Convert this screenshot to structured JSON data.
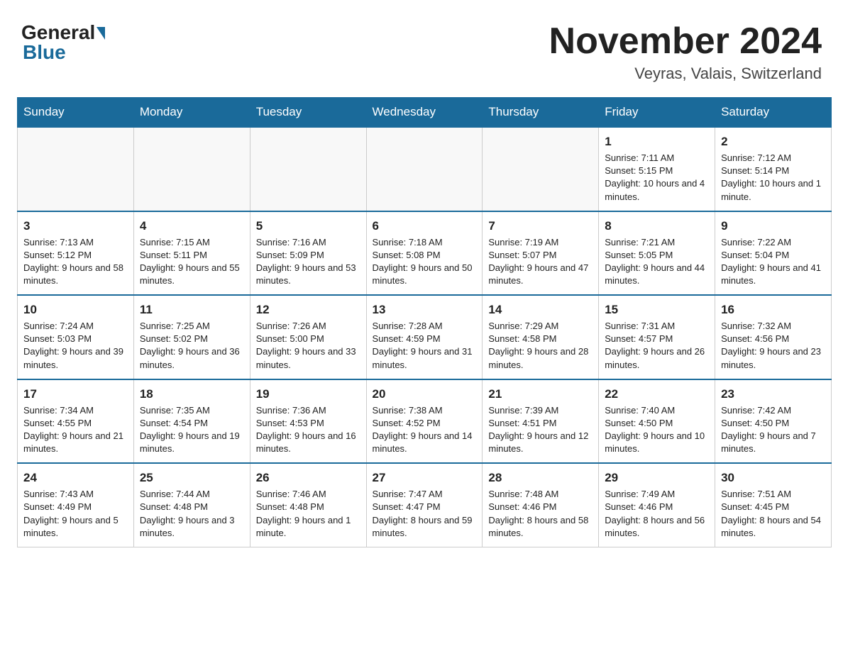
{
  "header": {
    "logo_general": "General",
    "logo_blue": "Blue",
    "month_title": "November 2024",
    "location": "Veyras, Valais, Switzerland"
  },
  "days_of_week": [
    "Sunday",
    "Monday",
    "Tuesday",
    "Wednesday",
    "Thursday",
    "Friday",
    "Saturday"
  ],
  "weeks": [
    [
      {
        "day": "",
        "info": ""
      },
      {
        "day": "",
        "info": ""
      },
      {
        "day": "",
        "info": ""
      },
      {
        "day": "",
        "info": ""
      },
      {
        "day": "",
        "info": ""
      },
      {
        "day": "1",
        "info": "Sunrise: 7:11 AM\nSunset: 5:15 PM\nDaylight: 10 hours and 4 minutes."
      },
      {
        "day": "2",
        "info": "Sunrise: 7:12 AM\nSunset: 5:14 PM\nDaylight: 10 hours and 1 minute."
      }
    ],
    [
      {
        "day": "3",
        "info": "Sunrise: 7:13 AM\nSunset: 5:12 PM\nDaylight: 9 hours and 58 minutes."
      },
      {
        "day": "4",
        "info": "Sunrise: 7:15 AM\nSunset: 5:11 PM\nDaylight: 9 hours and 55 minutes."
      },
      {
        "day": "5",
        "info": "Sunrise: 7:16 AM\nSunset: 5:09 PM\nDaylight: 9 hours and 53 minutes."
      },
      {
        "day": "6",
        "info": "Sunrise: 7:18 AM\nSunset: 5:08 PM\nDaylight: 9 hours and 50 minutes."
      },
      {
        "day": "7",
        "info": "Sunrise: 7:19 AM\nSunset: 5:07 PM\nDaylight: 9 hours and 47 minutes."
      },
      {
        "day": "8",
        "info": "Sunrise: 7:21 AM\nSunset: 5:05 PM\nDaylight: 9 hours and 44 minutes."
      },
      {
        "day": "9",
        "info": "Sunrise: 7:22 AM\nSunset: 5:04 PM\nDaylight: 9 hours and 41 minutes."
      }
    ],
    [
      {
        "day": "10",
        "info": "Sunrise: 7:24 AM\nSunset: 5:03 PM\nDaylight: 9 hours and 39 minutes."
      },
      {
        "day": "11",
        "info": "Sunrise: 7:25 AM\nSunset: 5:02 PM\nDaylight: 9 hours and 36 minutes."
      },
      {
        "day": "12",
        "info": "Sunrise: 7:26 AM\nSunset: 5:00 PM\nDaylight: 9 hours and 33 minutes."
      },
      {
        "day": "13",
        "info": "Sunrise: 7:28 AM\nSunset: 4:59 PM\nDaylight: 9 hours and 31 minutes."
      },
      {
        "day": "14",
        "info": "Sunrise: 7:29 AM\nSunset: 4:58 PM\nDaylight: 9 hours and 28 minutes."
      },
      {
        "day": "15",
        "info": "Sunrise: 7:31 AM\nSunset: 4:57 PM\nDaylight: 9 hours and 26 minutes."
      },
      {
        "day": "16",
        "info": "Sunrise: 7:32 AM\nSunset: 4:56 PM\nDaylight: 9 hours and 23 minutes."
      }
    ],
    [
      {
        "day": "17",
        "info": "Sunrise: 7:34 AM\nSunset: 4:55 PM\nDaylight: 9 hours and 21 minutes."
      },
      {
        "day": "18",
        "info": "Sunrise: 7:35 AM\nSunset: 4:54 PM\nDaylight: 9 hours and 19 minutes."
      },
      {
        "day": "19",
        "info": "Sunrise: 7:36 AM\nSunset: 4:53 PM\nDaylight: 9 hours and 16 minutes."
      },
      {
        "day": "20",
        "info": "Sunrise: 7:38 AM\nSunset: 4:52 PM\nDaylight: 9 hours and 14 minutes."
      },
      {
        "day": "21",
        "info": "Sunrise: 7:39 AM\nSunset: 4:51 PM\nDaylight: 9 hours and 12 minutes."
      },
      {
        "day": "22",
        "info": "Sunrise: 7:40 AM\nSunset: 4:50 PM\nDaylight: 9 hours and 10 minutes."
      },
      {
        "day": "23",
        "info": "Sunrise: 7:42 AM\nSunset: 4:50 PM\nDaylight: 9 hours and 7 minutes."
      }
    ],
    [
      {
        "day": "24",
        "info": "Sunrise: 7:43 AM\nSunset: 4:49 PM\nDaylight: 9 hours and 5 minutes."
      },
      {
        "day": "25",
        "info": "Sunrise: 7:44 AM\nSunset: 4:48 PM\nDaylight: 9 hours and 3 minutes."
      },
      {
        "day": "26",
        "info": "Sunrise: 7:46 AM\nSunset: 4:48 PM\nDaylight: 9 hours and 1 minute."
      },
      {
        "day": "27",
        "info": "Sunrise: 7:47 AM\nSunset: 4:47 PM\nDaylight: 8 hours and 59 minutes."
      },
      {
        "day": "28",
        "info": "Sunrise: 7:48 AM\nSunset: 4:46 PM\nDaylight: 8 hours and 58 minutes."
      },
      {
        "day": "29",
        "info": "Sunrise: 7:49 AM\nSunset: 4:46 PM\nDaylight: 8 hours and 56 minutes."
      },
      {
        "day": "30",
        "info": "Sunrise: 7:51 AM\nSunset: 4:45 PM\nDaylight: 8 hours and 54 minutes."
      }
    ]
  ]
}
